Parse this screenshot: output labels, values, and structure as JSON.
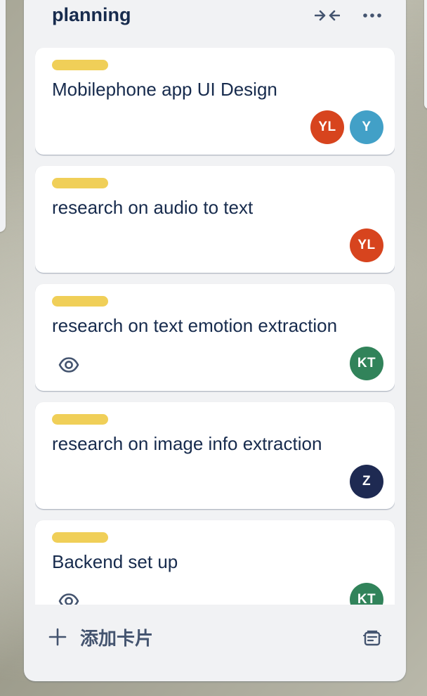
{
  "list": {
    "title": "planning",
    "add_card_label": "添加卡片",
    "icons": {
      "collapse": "collapse-arrows-icon",
      "more": "more-dots-icon",
      "add": "plus-icon",
      "template": "card-template-icon"
    }
  },
  "cards": [
    {
      "title": "Mobilephone app UI Design",
      "label_color": "#f0cf58",
      "watching": false,
      "members": [
        {
          "initials": "YL",
          "color": "#d7441e"
        },
        {
          "initials": "Y",
          "color": "#42a0c7"
        }
      ]
    },
    {
      "title": "research on audio to text",
      "label_color": "#f0cf58",
      "watching": false,
      "members": [
        {
          "initials": "YL",
          "color": "#d7441e"
        }
      ]
    },
    {
      "title": "research on text emotion extraction",
      "label_color": "#f0cf58",
      "watching": true,
      "members": [
        {
          "initials": "KT",
          "color": "#31835a"
        }
      ]
    },
    {
      "title": "research on image info extraction",
      "label_color": "#f0cf58",
      "watching": false,
      "members": [
        {
          "initials": "Z",
          "color": "#1e2a52"
        }
      ]
    },
    {
      "title": "Backend set up",
      "label_color": "#f0cf58",
      "watching": true,
      "members": [
        {
          "initials": "KT",
          "color": "#31835a"
        }
      ]
    }
  ]
}
